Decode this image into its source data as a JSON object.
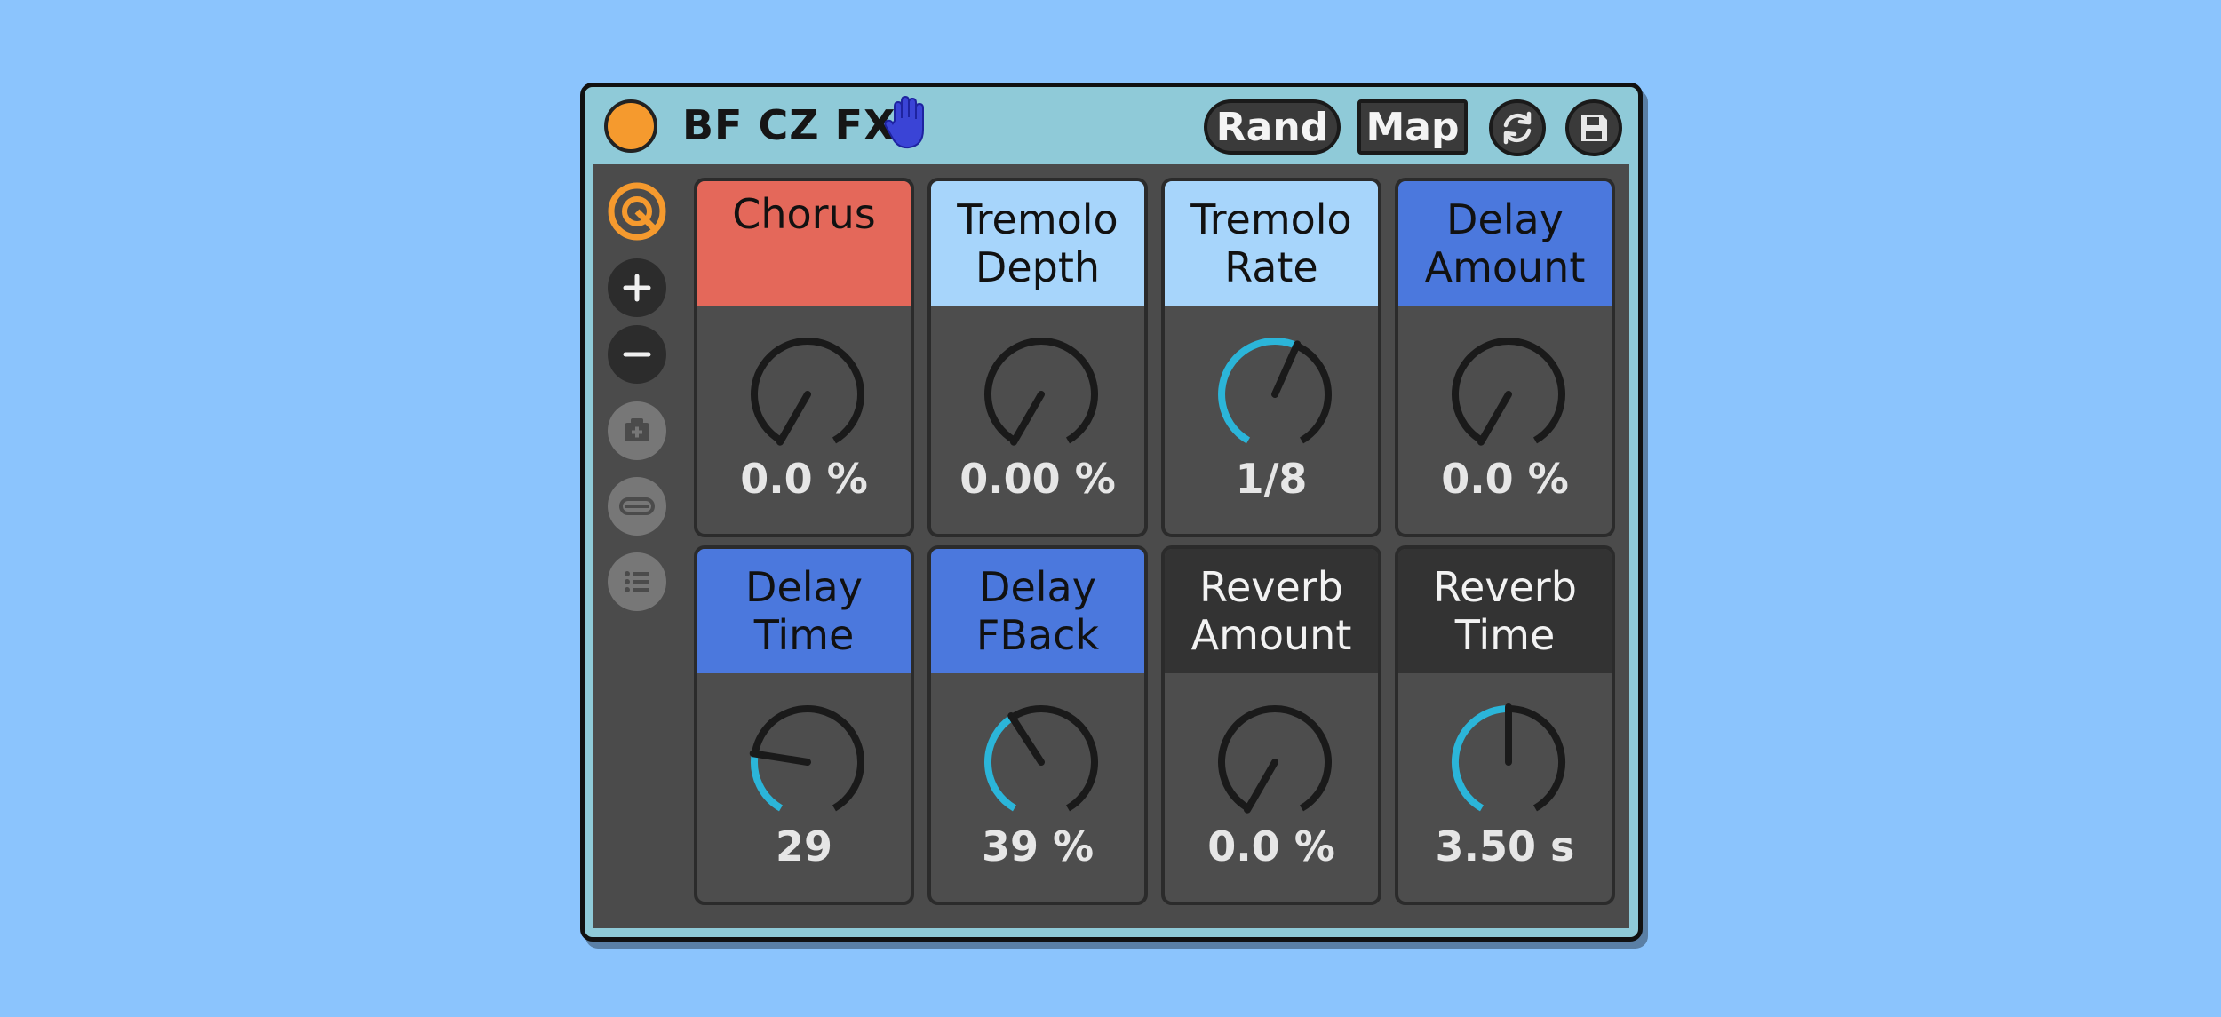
{
  "device": {
    "title": "BF CZ FX",
    "rand_label": "Rand",
    "map_label": "Map",
    "sidebar_icons": [
      "hot-swap-icon",
      "plus-icon",
      "minus-icon",
      "add-variation-icon",
      "remove-icon",
      "list-icon"
    ]
  },
  "colors": {
    "background": "#8bc4fd",
    "device_frame": "#8fcad8",
    "power": "#f59a2e",
    "knob_arc": "#2bb5d9",
    "red_label": "#e4685a",
    "light_blue_label": "#a7d5fb",
    "blue_label": "#4b78dd",
    "dark_label": "#333333"
  },
  "macros": [
    {
      "label": "Chorus",
      "value": "0.0 %",
      "level": 0.0,
      "color": "#e4685a",
      "text_color": "#111111",
      "top": true
    },
    {
      "label": "Tremolo\nDepth",
      "value": "0.00 %",
      "level": 0.0,
      "color": "#a7d5fb",
      "text_color": "#111111",
      "top": false
    },
    {
      "label": "Tremolo\nRate",
      "value": "1/8",
      "level": 0.58,
      "color": "#a7d5fb",
      "text_color": "#111111",
      "top": false
    },
    {
      "label": "Delay\nAmount",
      "value": "0.0 %",
      "level": 0.0,
      "color": "#4b78dd",
      "text_color": "#111111",
      "top": false
    },
    {
      "label": "Delay\nTime",
      "value": "29",
      "level": 0.23,
      "color": "#4b78dd",
      "text_color": "#111111",
      "top": false
    },
    {
      "label": "Delay\nFBack",
      "value": "39 %",
      "level": 0.39,
      "color": "#4b78dd",
      "text_color": "#111111",
      "top": false
    },
    {
      "label": "Reverb\nAmount",
      "value": "0.0 %",
      "level": 0.0,
      "color": "#333333",
      "text_color": "#f2f2f2",
      "top": false
    },
    {
      "label": "Reverb\nTime",
      "value": "3.50 s",
      "level": 0.5,
      "color": "#333333",
      "text_color": "#f2f2f2",
      "top": false
    }
  ]
}
